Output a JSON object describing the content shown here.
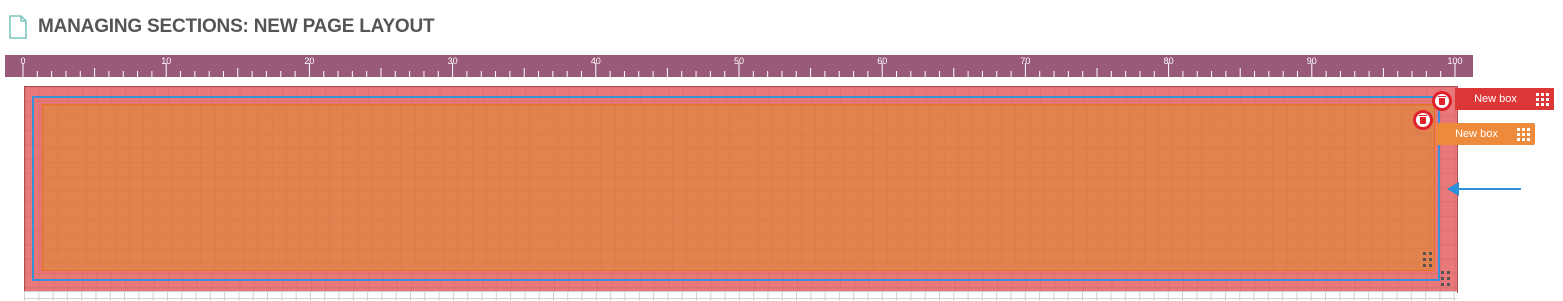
{
  "header": {
    "icon": "document-icon",
    "title": "MANAGING SECTIONS: NEW PAGE LAYOUT"
  },
  "ruler": {
    "labels": [
      "0",
      "10",
      "20",
      "30",
      "40",
      "50",
      "60",
      "70",
      "80",
      "90",
      "100"
    ],
    "color": "#985a78"
  },
  "boxes": {
    "outer": {
      "label": "New box",
      "tag_color": "#dd3636",
      "border_color": "#3a8fd6"
    },
    "inner": {
      "label": "New box",
      "tag_color": "#ee8a3c",
      "fill_color": "#e1824f"
    }
  },
  "icons": {
    "delete": "trash-icon",
    "drag": "drag-handle-icon",
    "resize": "resize-handle-icon",
    "arrow": "arrow-left-icon"
  },
  "colors": {
    "canvas": "#e8787a",
    "arrow": "#2b8fd9",
    "delete": "#e0202a"
  }
}
